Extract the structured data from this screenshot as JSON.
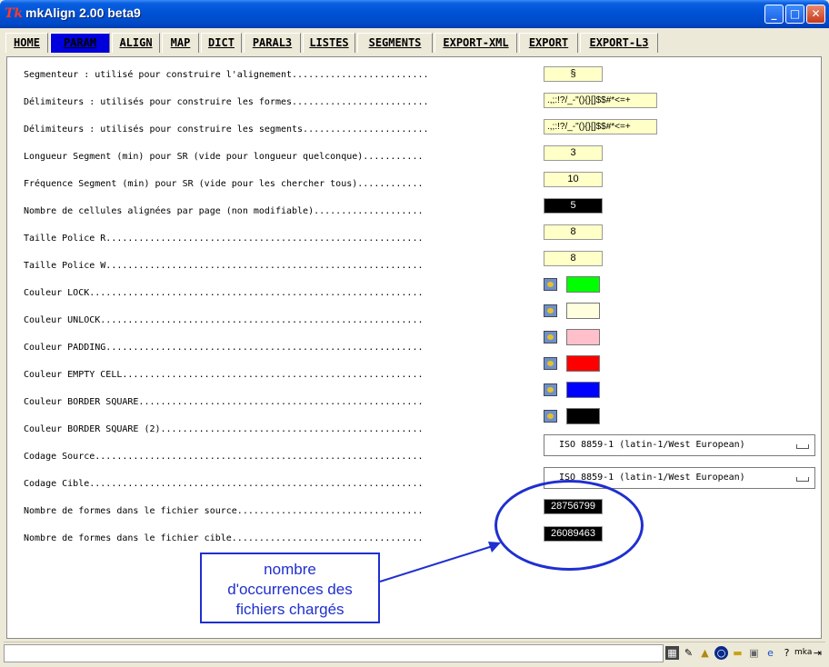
{
  "window": {
    "title": "mkAlign 2.00 beta9",
    "app_icon": "tk-feather-icon",
    "controls": [
      "minimize-icon",
      "maximize-icon",
      "close-icon"
    ]
  },
  "tabs": [
    {
      "label": "HOME",
      "active": false
    },
    {
      "label": "PARAM",
      "active": true
    },
    {
      "label": "ALIGN",
      "active": false
    },
    {
      "label": "MAP",
      "active": false
    },
    {
      "label": "DICT",
      "active": false
    },
    {
      "label": "PARAL3",
      "active": false
    },
    {
      "label": "LISTES",
      "active": false
    },
    {
      "label": "SEGMENTS",
      "active": false
    },
    {
      "label": "EXPORT-XML",
      "active": false
    },
    {
      "label": "EXPORT",
      "active": false
    },
    {
      "label": "EXPORT-L3",
      "active": false
    }
  ],
  "params": [
    {
      "label": "Segmenteur : utilisé pour construire l'alignement.........................",
      "value": "§"
    },
    {
      "label": "Délimiteurs : utilisés pour construire les formes.........................",
      "value": ".,;:!?/_-\"(){}[]$$#*<=+"
    },
    {
      "label": "Délimiteurs : utilisés pour construire les segments.......................",
      "value": ".,;:!?/_-\"(){}[]$$#*<=+"
    },
    {
      "label": "Longueur Segment (min) pour SR (vide pour longueur quelconque)...........",
      "value": "3"
    },
    {
      "label": "Fréquence Segment (min) pour SR (vide pour les chercher tous)............",
      "value": "10"
    },
    {
      "label": "Nombre de cellules alignées par page (non modifiable)....................",
      "value": "5"
    },
    {
      "label": "Taille Police R..........................................................",
      "value": "8"
    },
    {
      "label": "Taille Police W..........................................................",
      "value": "8"
    },
    {
      "label": "Couleur LOCK.............................................................",
      "color": "#00ff00"
    },
    {
      "label": "Couleur UNLOCK...........................................................",
      "color": "#ffffe0"
    },
    {
      "label": "Couleur PADDING..........................................................",
      "color": "#ffc0cb"
    },
    {
      "label": "Couleur EMPTY CELL.......................................................",
      "color": "#ff0000"
    },
    {
      "label": "Couleur BORDER SQUARE....................................................",
      "color": "#0000ff"
    },
    {
      "label": "Couleur BORDER SQUARE (2)................................................",
      "color": "#000000"
    },
    {
      "label": "Codage Source............................................................",
      "select": "ISO 8859-1 (latin-1/West European)"
    },
    {
      "label": "Codage Cible.............................................................",
      "select": "ISO 8859-1 (latin-1/West European)"
    },
    {
      "label": "Nombre de formes dans le fichier source..................................",
      "value": "28756799"
    },
    {
      "label": "Nombre de formes dans le fichier cible...................................",
      "value": "26089463"
    }
  ],
  "annotation": {
    "line1": "nombre",
    "line2": "d'occurrences des",
    "line3": "fichiers chargés"
  },
  "statusbar": {
    "icons": [
      "config-icon",
      "pen-icon",
      "open-icon",
      "globe-icon",
      "folder-icon",
      "image-icon",
      "ie-icon",
      "help-icon",
      "mka-icon",
      "exit-icon"
    ],
    "help_glyph": "?",
    "mka_text": "mka"
  }
}
